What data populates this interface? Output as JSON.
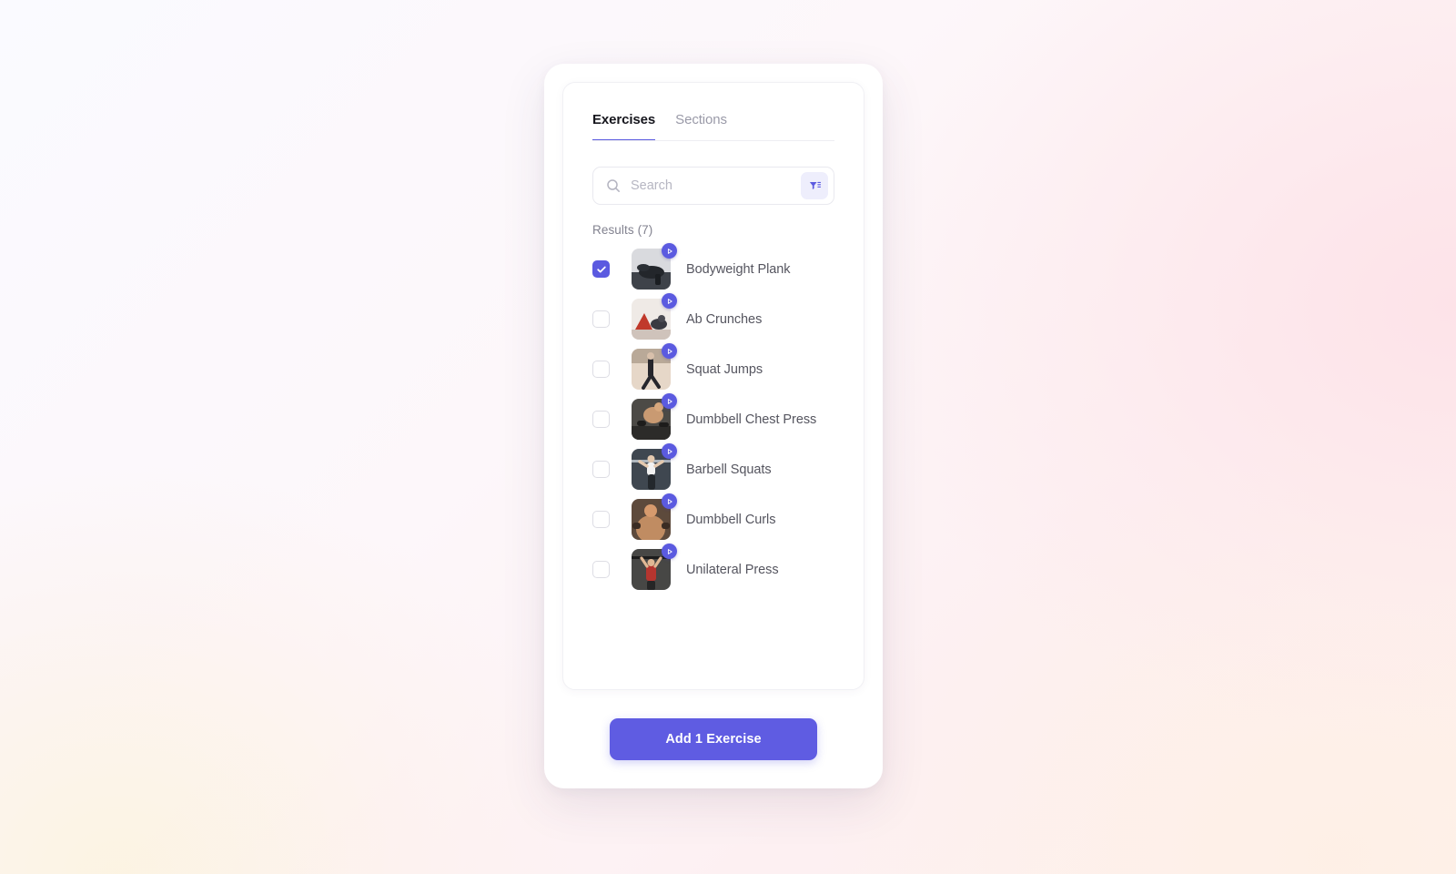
{
  "tabs": [
    {
      "label": "Exercises",
      "active": true
    },
    {
      "label": "Sections",
      "active": false
    }
  ],
  "search": {
    "placeholder": "Search",
    "value": "",
    "search_icon": "search-icon",
    "filter_icon": "filter-icon"
  },
  "results": {
    "label": "Results (7)",
    "count": 7
  },
  "exercises": [
    {
      "name": "Bodyweight Plank",
      "checked": true,
      "play_icon": "play-icon"
    },
    {
      "name": "Ab Crunches",
      "checked": false,
      "play_icon": "play-icon"
    },
    {
      "name": "Squat Jumps",
      "checked": false,
      "play_icon": "play-icon"
    },
    {
      "name": "Dumbbell Chest Press",
      "checked": false,
      "play_icon": "play-icon"
    },
    {
      "name": "Barbell Squats",
      "checked": false,
      "play_icon": "play-icon"
    },
    {
      "name": "Dumbbell Curls",
      "checked": false,
      "play_icon": "play-icon"
    },
    {
      "name": "Unilateral Press",
      "checked": false,
      "play_icon": "play-icon"
    }
  ],
  "footer": {
    "add_label": "Add 1 Exercise"
  },
  "colors": {
    "accent": "#5b5ae0",
    "button": "#5f5ce2",
    "tab_active_text": "#16161d",
    "tab_inactive_text": "#9a9aa8",
    "row_text": "#55555f",
    "results_text": "#82828f",
    "filter_bg": "#eeeefc"
  }
}
